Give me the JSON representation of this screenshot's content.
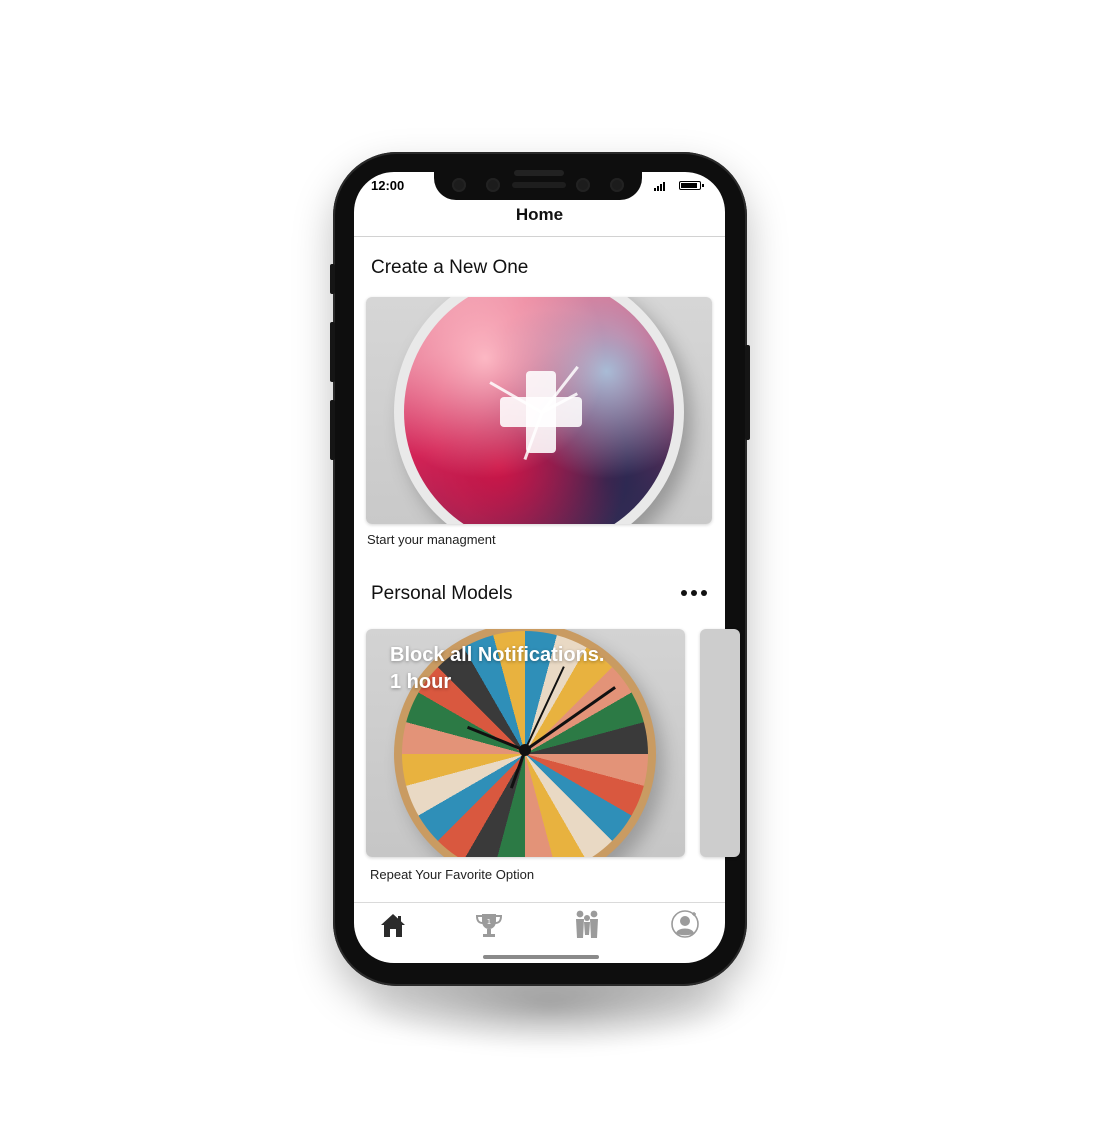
{
  "status_bar": {
    "time": "12:00"
  },
  "nav": {
    "title": "Home"
  },
  "create_section": {
    "title": "Create a New One",
    "card_icon": "plus-icon",
    "caption": "Start your managment"
  },
  "personal_section": {
    "title": "Personal Models",
    "more_icon": "more-horizontal-icon",
    "cards": [
      {
        "overlay_line1": "Block all Notifications.",
        "overlay_line2": "1 hour",
        "caption": "Repeat Your Favorite Option"
      }
    ]
  },
  "tab_bar": {
    "tabs": [
      {
        "name": "home",
        "icon": "home-icon",
        "active": true
      },
      {
        "name": "trophy",
        "icon": "trophy-icon",
        "active": false
      },
      {
        "name": "community",
        "icon": "people-icon",
        "active": false
      },
      {
        "name": "profile",
        "icon": "profile-icon",
        "active": false
      }
    ]
  },
  "colors": {
    "active_tab": "#2b2b2b",
    "inactive_tab": "#9b9b9b",
    "text": "#111111"
  }
}
